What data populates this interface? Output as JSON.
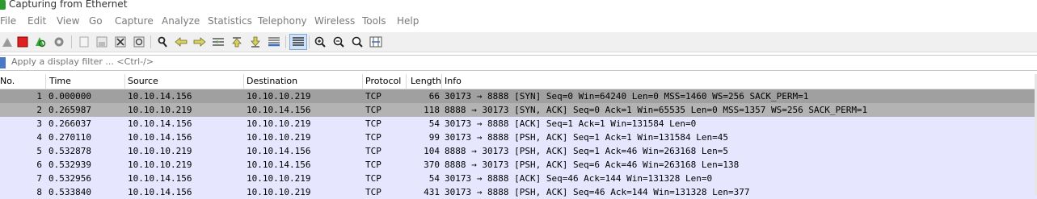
{
  "window": {
    "title": "Capturing from Ethernet",
    "icon": "wireshark-fin-icon"
  },
  "menu": [
    "File",
    "Edit",
    "View",
    "Go",
    "Capture",
    "Analyze",
    "Statistics",
    "Telephony",
    "Wireless",
    "Tools",
    "Help"
  ],
  "toolbar": {
    "icons": [
      "shark-fin-start-icon",
      "stop-capture-icon",
      "restart-capture-icon",
      "capture-options-icon",
      "open-file-icon",
      "save-file-icon",
      "close-file-icon",
      "reload-file-icon",
      "find-packet-icon",
      "go-back-icon",
      "go-forward-icon",
      "go-to-packet-icon",
      "go-first-icon",
      "go-last-icon",
      "autoscroll-icon",
      "colorize-icon",
      "zoom-in-icon",
      "zoom-out-icon",
      "zoom-normal-icon",
      "resize-columns-icon"
    ]
  },
  "filter": {
    "placeholder": "Apply a display filter ... <Ctrl-/>"
  },
  "columns": [
    "No.",
    "Time",
    "Source",
    "Destination",
    "Protocol",
    "Length",
    "Info"
  ],
  "colors": {
    "selected_row": "#a0a0a0",
    "second_row": "#b3b3b3",
    "tcp_row": "#e7e6ff",
    "accent": "#4a79c8"
  },
  "packets": [
    {
      "no": "1",
      "time": "0.000000",
      "src": "10.10.14.156",
      "dst": "10.10.10.219",
      "proto": "TCP",
      "len": "66",
      "info": "30173 → 8888 [SYN] Seq=0 Win=64240 Len=0 MSS=1460 WS=256 SACK_PERM=1"
    },
    {
      "no": "2",
      "time": "0.265987",
      "src": "10.10.10.219",
      "dst": "10.10.14.156",
      "proto": "TCP",
      "len": "118",
      "info": "8888 → 30173 [SYN, ACK] Seq=0 Ack=1 Win=65535 Len=0 MSS=1357 WS=256 SACK_PERM=1"
    },
    {
      "no": "3",
      "time": "0.266037",
      "src": "10.10.14.156",
      "dst": "10.10.10.219",
      "proto": "TCP",
      "len": "54",
      "info": "30173 → 8888 [ACK] Seq=1 Ack=1 Win=131584 Len=0"
    },
    {
      "no": "4",
      "time": "0.270110",
      "src": "10.10.14.156",
      "dst": "10.10.10.219",
      "proto": "TCP",
      "len": "99",
      "info": "30173 → 8888 [PSH, ACK] Seq=1 Ack=1 Win=131584 Len=45"
    },
    {
      "no": "5",
      "time": "0.532878",
      "src": "10.10.10.219",
      "dst": "10.10.14.156",
      "proto": "TCP",
      "len": "104",
      "info": "8888 → 30173 [PSH, ACK] Seq=1 Ack=46 Win=263168 Len=5"
    },
    {
      "no": "6",
      "time": "0.532939",
      "src": "10.10.10.219",
      "dst": "10.10.14.156",
      "proto": "TCP",
      "len": "370",
      "info": "8888 → 30173 [PSH, ACK] Seq=6 Ack=46 Win=263168 Len=138"
    },
    {
      "no": "7",
      "time": "0.532956",
      "src": "10.10.14.156",
      "dst": "10.10.10.219",
      "proto": "TCP",
      "len": "54",
      "info": "30173 → 8888 [ACK] Seq=46 Ack=144 Win=131328 Len=0"
    },
    {
      "no": "8",
      "time": "0.533840",
      "src": "10.10.14.156",
      "dst": "10.10.10.219",
      "proto": "TCP",
      "len": "431",
      "info": "30173 → 8888 [PSH, ACK] Seq=46 Ack=144 Win=131328 Len=377"
    }
  ]
}
